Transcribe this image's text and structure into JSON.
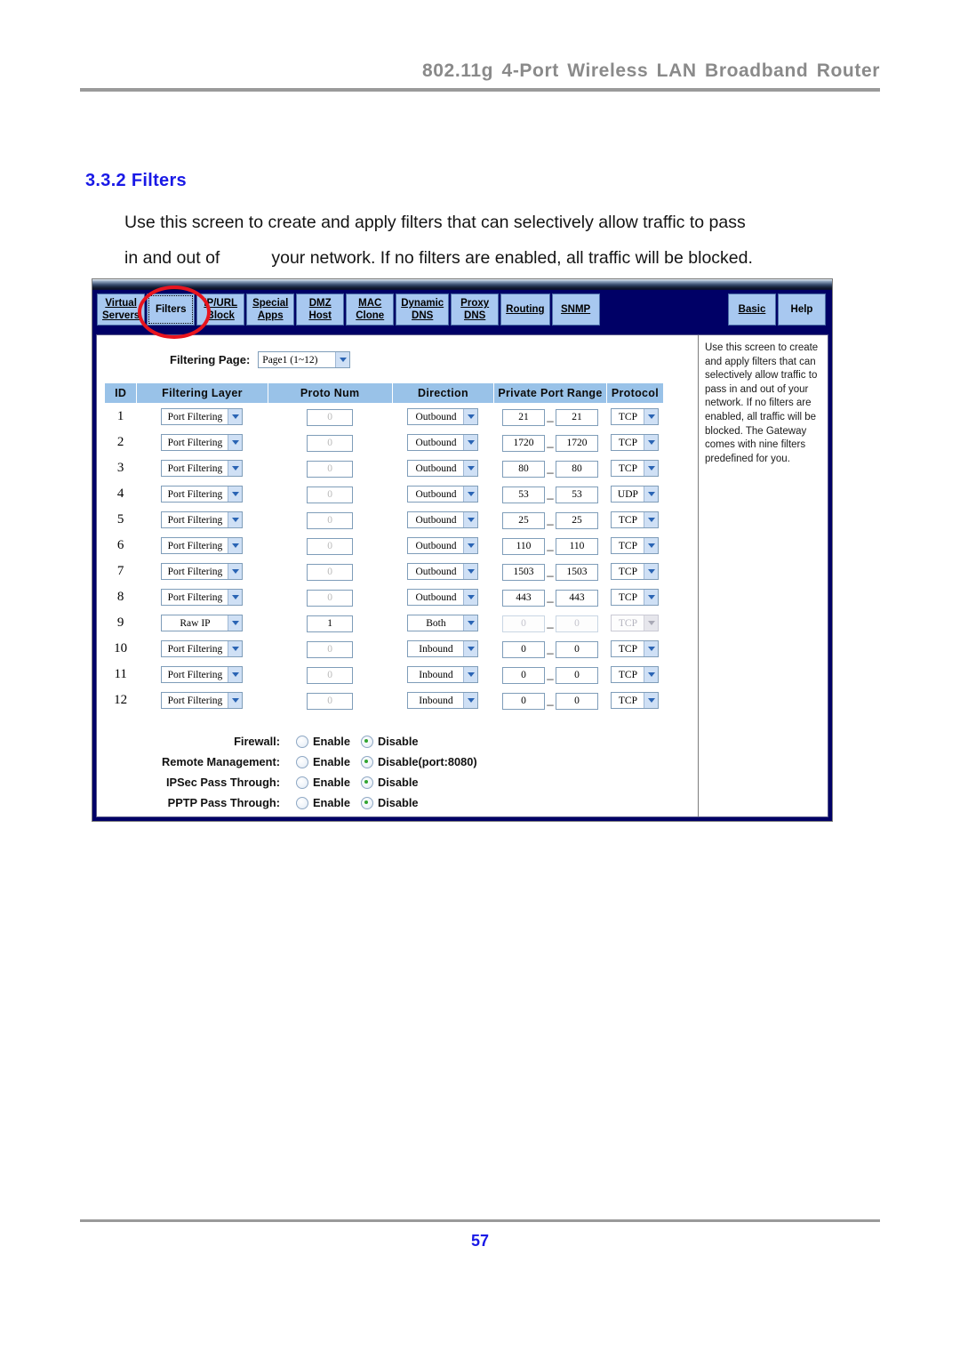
{
  "document": {
    "header_title": "802.11g 4-Port Wireless LAN Broadband Router",
    "section_number_title": "3.3.2 Filters",
    "body_line1": "Use this screen to create and apply filters that can selectively allow traffic to pass",
    "body_line2a": "in and out of",
    "body_line2b": "your network. If no filters are enabled, all traffic will be blocked.",
    "page_number": "57"
  },
  "router_ui": {
    "nav_tabs": [
      {
        "line1": "Virtual",
        "line2": "Servers",
        "active": false,
        "link": true
      },
      {
        "line1": "Filters",
        "line2": "",
        "active": true,
        "link": true
      },
      {
        "line1": "IP/URL",
        "line2": "Block",
        "active": false,
        "link": true
      },
      {
        "line1": "Special",
        "line2": "Apps",
        "active": false,
        "link": true
      },
      {
        "line1": "DMZ",
        "line2": "Host",
        "active": false,
        "link": true
      },
      {
        "line1": "MAC",
        "line2": "Clone",
        "active": false,
        "link": true
      },
      {
        "line1": "Dynamic",
        "line2": "DNS",
        "active": false,
        "link": true
      },
      {
        "line1": "Proxy",
        "line2": "DNS",
        "active": false,
        "link": true
      },
      {
        "line1": "Routing",
        "line2": "",
        "active": false,
        "link": true
      },
      {
        "line1": "SNMP",
        "line2": "",
        "active": false,
        "link": true
      }
    ],
    "nav_tabs_right": [
      {
        "line1": "Basic",
        "line2": "",
        "link": true
      },
      {
        "line1": "Help",
        "line2": "",
        "link": false
      }
    ],
    "filtering_page": {
      "label": "Filtering Page:",
      "value": "Page1 (1~12)"
    },
    "table": {
      "headers": [
        "ID",
        "Filtering Layer",
        "Proto Num",
        "Direction",
        "Private Port Range",
        "Protocol"
      ],
      "rows": [
        {
          "id": "1",
          "layer": "Port Filtering",
          "proto_num": "0",
          "proto_dim": true,
          "direction": "Outbound",
          "port_start": "21",
          "port_end": "21",
          "protocol": "TCP",
          "disabled": false
        },
        {
          "id": "2",
          "layer": "Port Filtering",
          "proto_num": "0",
          "proto_dim": true,
          "direction": "Outbound",
          "port_start": "1720",
          "port_end": "1720",
          "protocol": "TCP",
          "disabled": false
        },
        {
          "id": "3",
          "layer": "Port Filtering",
          "proto_num": "0",
          "proto_dim": true,
          "direction": "Outbound",
          "port_start": "80",
          "port_end": "80",
          "protocol": "TCP",
          "disabled": false
        },
        {
          "id": "4",
          "layer": "Port Filtering",
          "proto_num": "0",
          "proto_dim": true,
          "direction": "Outbound",
          "port_start": "53",
          "port_end": "53",
          "protocol": "UDP",
          "disabled": false
        },
        {
          "id": "5",
          "layer": "Port Filtering",
          "proto_num": "0",
          "proto_dim": true,
          "direction": "Outbound",
          "port_start": "25",
          "port_end": "25",
          "protocol": "TCP",
          "disabled": false
        },
        {
          "id": "6",
          "layer": "Port Filtering",
          "proto_num": "0",
          "proto_dim": true,
          "direction": "Outbound",
          "port_start": "110",
          "port_end": "110",
          "protocol": "TCP",
          "disabled": false
        },
        {
          "id": "7",
          "layer": "Port Filtering",
          "proto_num": "0",
          "proto_dim": true,
          "direction": "Outbound",
          "port_start": "1503",
          "port_end": "1503",
          "protocol": "TCP",
          "disabled": false
        },
        {
          "id": "8",
          "layer": "Port Filtering",
          "proto_num": "0",
          "proto_dim": true,
          "direction": "Outbound",
          "port_start": "443",
          "port_end": "443",
          "protocol": "TCP",
          "disabled": false
        },
        {
          "id": "9",
          "layer": "Raw IP",
          "proto_num": "1",
          "proto_dim": false,
          "direction": "Both",
          "port_start": "0",
          "port_end": "0",
          "protocol": "TCP",
          "disabled": true
        },
        {
          "id": "10",
          "layer": "Port Filtering",
          "proto_num": "0",
          "proto_dim": true,
          "direction": "Inbound",
          "port_start": "0",
          "port_end": "0",
          "protocol": "TCP",
          "disabled": false
        },
        {
          "id": "11",
          "layer": "Port Filtering",
          "proto_num": "0",
          "proto_dim": true,
          "direction": "Inbound",
          "port_start": "0",
          "port_end": "0",
          "protocol": "TCP",
          "disabled": false
        },
        {
          "id": "12",
          "layer": "Port Filtering",
          "proto_num": "0",
          "proto_dim": true,
          "direction": "Inbound",
          "port_start": "0",
          "port_end": "0",
          "protocol": "TCP",
          "disabled": false
        }
      ]
    },
    "options": [
      {
        "label": "Firewall:",
        "enable_label": "Enable",
        "disable_label": "Disable",
        "selected": "disable"
      },
      {
        "label": "Remote Management:",
        "enable_label": "Enable",
        "disable_label": "Disable(port:8080)",
        "selected": "disable"
      },
      {
        "label": "IPSec Pass Through:",
        "enable_label": "Enable",
        "disable_label": "Disable",
        "selected": "disable"
      },
      {
        "label": "PPTP Pass Through:",
        "enable_label": "Enable",
        "disable_label": "Disable",
        "selected": "disable"
      }
    ],
    "help_text": "Use this screen to create and apply filters that can selectively allow traffic to pass in and out of your network. If no filters are enabled, all traffic will be blocked. The Gateway comes with nine filters predefined for you."
  }
}
